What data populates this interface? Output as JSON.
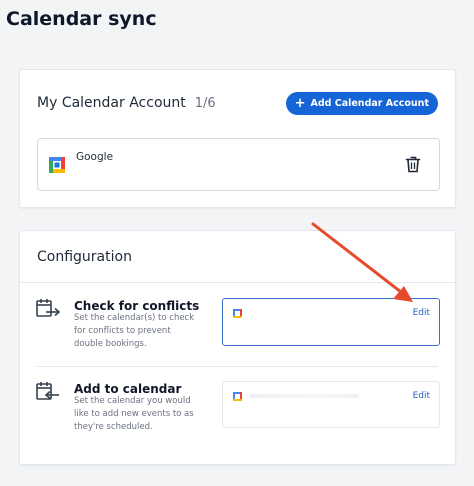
{
  "page": {
    "title": "Calendar sync"
  },
  "accounts_card": {
    "title": "My Calendar Account",
    "count": "1/6",
    "add_button_label": "Add Calendar Account",
    "accounts": [
      {
        "name": "Google",
        "icon": "google-calendar-icon"
      }
    ]
  },
  "configuration": {
    "title": "Configuration",
    "items": [
      {
        "title": "Check for conflicts",
        "description": "Set the calendar(s) to check for conflicts to prevent double bookings.",
        "edit_label": "Edit",
        "icon": "calendar-export-icon"
      },
      {
        "title": "Add to calendar",
        "description": "Set the calendar you would like to add new events to as they're scheduled.",
        "edit_label": "Edit",
        "icon": "calendar-import-icon"
      }
    ]
  },
  "colors": {
    "primary": "#1565d8",
    "arrow": "#e64a2e",
    "active_border": "#3b6fd0"
  }
}
